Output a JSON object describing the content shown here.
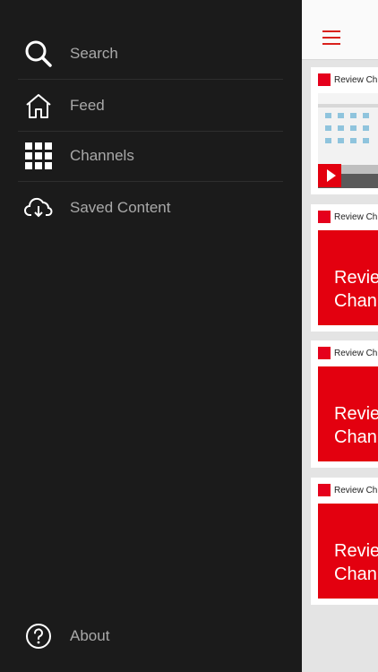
{
  "drawer": {
    "items": [
      {
        "label": "Search",
        "icon": "search-icon"
      },
      {
        "label": "Feed",
        "icon": "home-icon"
      },
      {
        "label": "Channels",
        "icon": "grid-icon"
      },
      {
        "label": "Saved Content",
        "icon": "cloud-download-icon"
      }
    ],
    "about": {
      "label": "About",
      "icon": "help-circle-icon"
    }
  },
  "content": {
    "menu_icon": "hamburger-icon",
    "accent_color": "#d9211c",
    "cards": [
      {
        "title": "Review Ch",
        "thumbnail": "video",
        "logo_text": "Review Channel"
      },
      {
        "title": "Review Ch",
        "thumbnail_text": "Revie Chann",
        "logo_text": "Review Channel"
      },
      {
        "title": "Review Ch",
        "thumbnail_text": "Revie Chann",
        "logo_text": "Review Channel"
      },
      {
        "title": "Review Ch",
        "thumbnail_text": "Revie Chann",
        "logo_text": "Review Channel"
      }
    ]
  }
}
